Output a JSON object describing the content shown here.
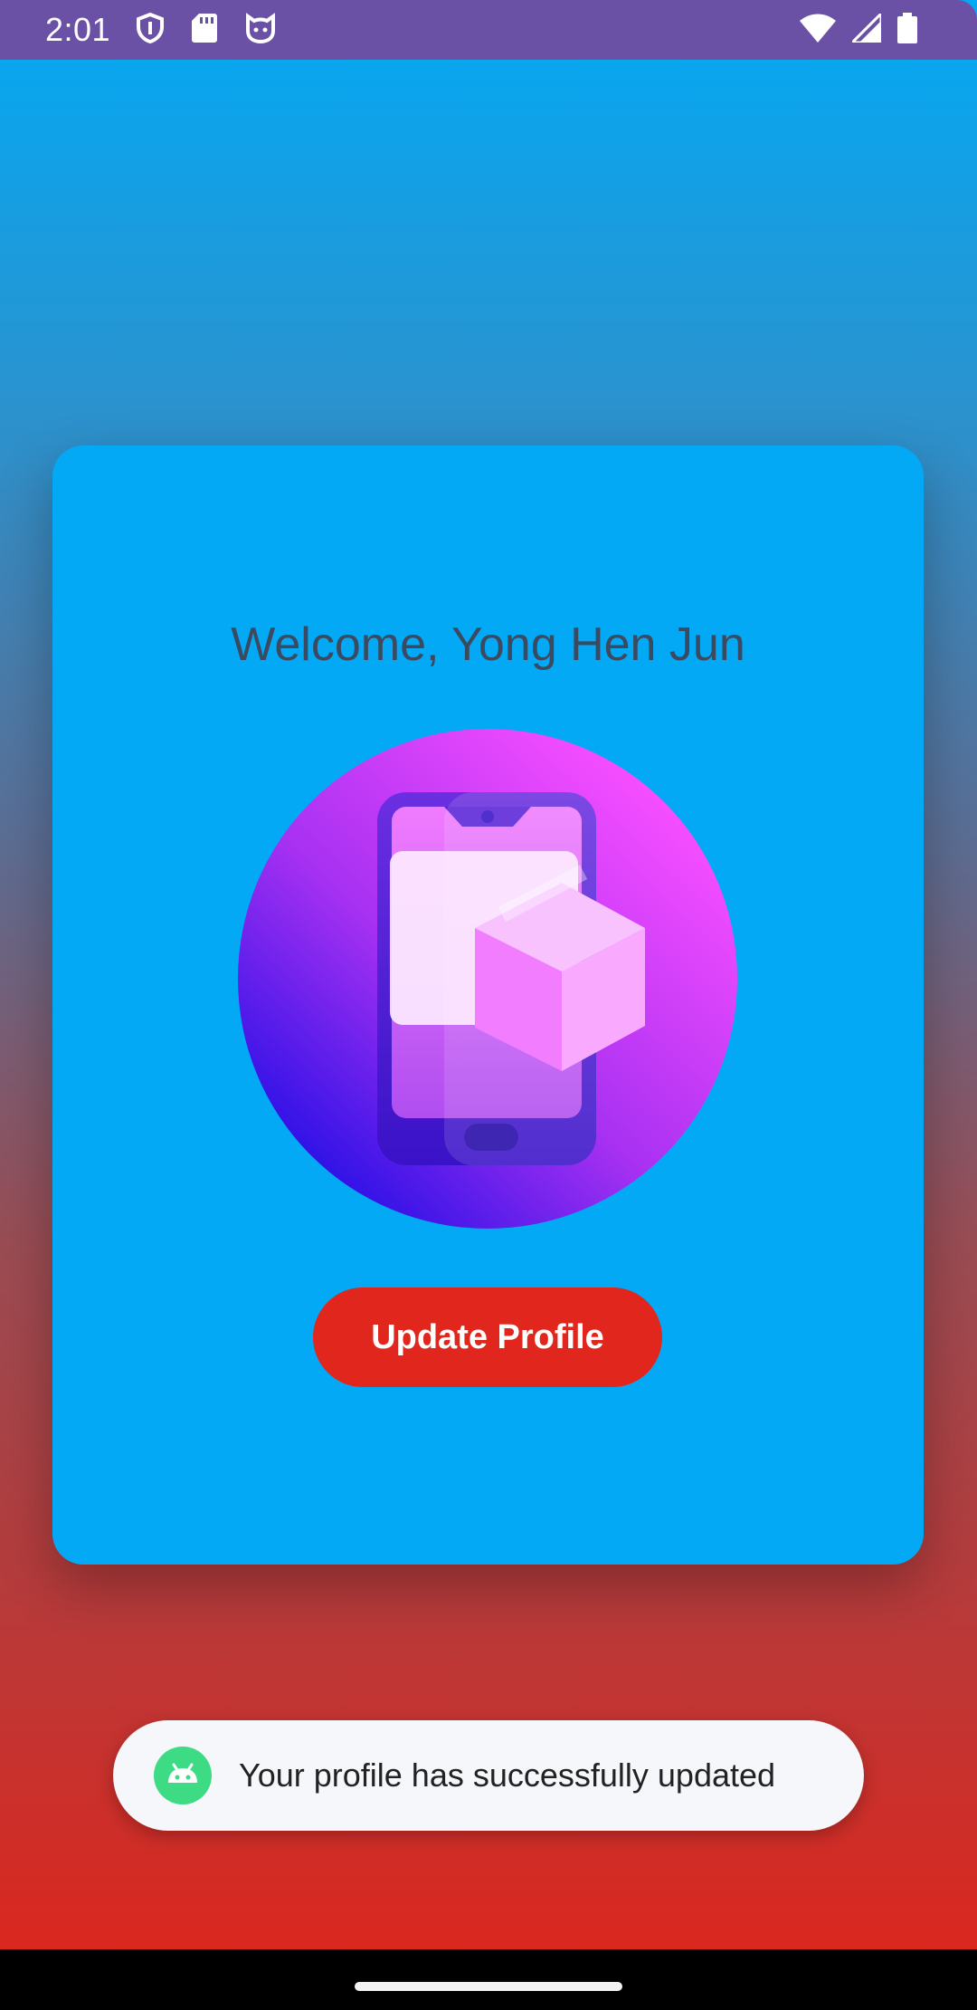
{
  "status_bar": {
    "time": "2:01",
    "left_icons": [
      "shield-icon",
      "sd-card-icon",
      "cat-face-icon"
    ],
    "right_icons": [
      "wifi-icon",
      "cell-signal-icon",
      "battery-icon"
    ],
    "color": "#6b51a6"
  },
  "card": {
    "welcome": "Welcome, Yong Hen Jun",
    "illustration_icon": "phone-box-illustration",
    "button_label": "Update Profile",
    "button_color": "#e1261d",
    "background": "#03a9f4"
  },
  "toast": {
    "icon": "android-icon",
    "message": "Your profile has successfully updated"
  }
}
